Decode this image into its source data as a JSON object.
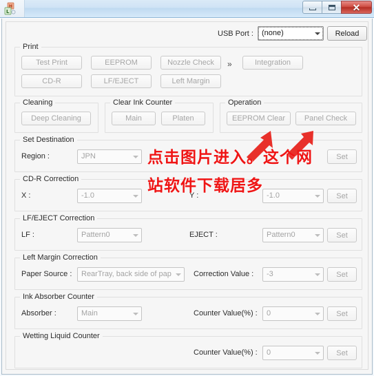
{
  "window": {
    "title": "",
    "icon": "printer-service-tool-icon",
    "controls": {
      "minimize": "minimize-icon",
      "maximize": "maximize-icon",
      "close": "✕"
    }
  },
  "toolbar": {
    "usb_port_label": "USB Port :",
    "usb_port_value": "(none)",
    "reload_label": "Reload"
  },
  "print": {
    "legend": "Print",
    "buttons": [
      {
        "label": "Test Print"
      },
      {
        "label": "EEPROM"
      },
      {
        "label": "Nozzle Check"
      },
      {
        "label": "Integration"
      },
      {
        "label": "CD-R"
      },
      {
        "label": "LF/EJECT"
      },
      {
        "label": "Left Margin"
      }
    ],
    "separator": "»"
  },
  "cleaning": {
    "legend": "Cleaning",
    "deep_cleaning_label": "Deep Cleaning"
  },
  "clear_ink_counter": {
    "legend": "Clear Ink Counter",
    "main_label": "Main",
    "platen_label": "Platen"
  },
  "operation": {
    "legend": "Operation",
    "eeprom_clear_label": "EEPROM Clear",
    "panel_check_label": "Panel Check"
  },
  "set_destination": {
    "legend": "Set Destination",
    "region_label": "Region :",
    "region_value": "JPN",
    "set_label": "Set"
  },
  "cdr_correction": {
    "legend": "CD-R Correction",
    "x_label": "X :",
    "x_value": "-1.0",
    "y_label": "Y :",
    "y_value": "-1.0",
    "set_label": "Set"
  },
  "lf_eject_correction": {
    "legend": "LF/EJECT Correction",
    "lf_label": "LF :",
    "lf_value": "Pattern0",
    "eject_label": "EJECT :",
    "eject_value": "Pattern0",
    "set_label": "Set"
  },
  "left_margin_correction": {
    "legend": "Left Margin Correction",
    "paper_source_label": "Paper Source :",
    "paper_source_value": "RearTray, back side of pap",
    "correction_value_label": "Correction Value :",
    "correction_value": "-3",
    "set_label": "Set"
  },
  "ink_absorber_counter": {
    "legend": "Ink Absorber Counter",
    "absorber_label": "Absorber :",
    "absorber_value": "Main",
    "counter_value_label": "Counter Value(%) :",
    "counter_value": "0",
    "set_label": "Set"
  },
  "wetting_liquid_counter": {
    "legend": "Wetting Liquid Counter",
    "counter_value_label": "Counter Value(%) :",
    "counter_value": "0",
    "set_label": "Set"
  },
  "annotation": {
    "color": "#ef1515",
    "line1": "点击图片进入。这个网",
    "line2": "站软件下载居多",
    "arrows": [
      {
        "name": "red-arrow-left"
      },
      {
        "name": "red-arrow-right"
      }
    ]
  }
}
